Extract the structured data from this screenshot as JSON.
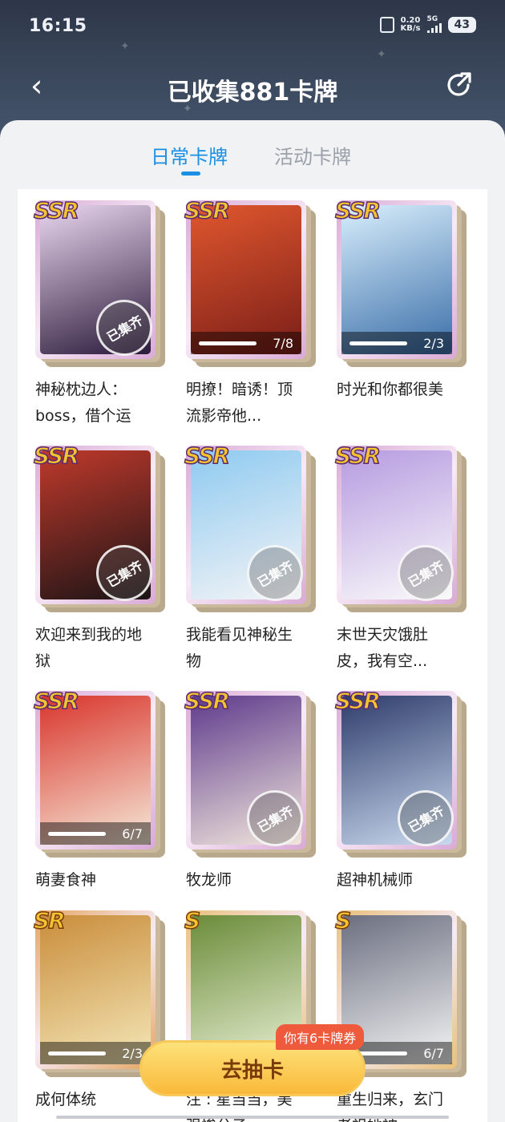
{
  "status_bar": {
    "time": "16:15",
    "speed_value": "0.20",
    "speed_unit": "KB/s",
    "network": "5G",
    "battery": "43"
  },
  "nav": {
    "title": "已收集881卡牌"
  },
  "tabs": [
    {
      "label": "日常卡牌",
      "active": true
    },
    {
      "label": "活动卡牌",
      "active": false
    }
  ],
  "cards": [
    {
      "rarity": "SSR",
      "title": "神秘枕边人：boss，借个运",
      "progress": "",
      "collected_stamp": "已集齐",
      "colors": [
        "#2b1a3a",
        "#e9d6ef"
      ],
      "frame": "#d9a9d6"
    },
    {
      "rarity": "SSR",
      "title": "明撩！暗诱！顶流影帝他...",
      "progress": "7/8",
      "collected_stamp": "",
      "colors": [
        "#7a1e18",
        "#e0572e"
      ],
      "frame": "#d9a9d6"
    },
    {
      "rarity": "SSR",
      "title": "时光和你都很美",
      "progress": "2/3",
      "collected_stamp": "",
      "colors": [
        "#3a6ea8",
        "#d8eefc"
      ],
      "frame": "#d9a9d6"
    },
    {
      "rarity": "SSR",
      "title": "欢迎来到我的地狱",
      "progress": "",
      "collected_stamp": "已集齐",
      "colors": [
        "#1b1416",
        "#c0392b"
      ],
      "frame": "#d9a9d6"
    },
    {
      "rarity": "SSR",
      "title": "我能看见神秘生物",
      "progress": "",
      "collected_stamp": "已集齐",
      "colors": [
        "#f4f4f6",
        "#8ecaf0"
      ],
      "frame": "#d9a9d6"
    },
    {
      "rarity": "SSR",
      "title": "末世天灾饿肚皮，我有空...",
      "progress": "",
      "collected_stamp": "已集齐",
      "colors": [
        "#fafafa",
        "#b69be0"
      ],
      "frame": "#d9a9d6"
    },
    {
      "rarity": "SSR",
      "title": "萌妻食神",
      "progress": "6/7",
      "collected_stamp": "",
      "colors": [
        "#f5e9d8",
        "#d9342b"
      ],
      "frame": "#d9a9d6"
    },
    {
      "rarity": "SSR",
      "title": "牧龙师",
      "progress": "",
      "collected_stamp": "已集齐",
      "colors": [
        "#f1e6dc",
        "#5e3a8c"
      ],
      "frame": "#d9a9d6"
    },
    {
      "rarity": "SSR",
      "title": "超神机械师",
      "progress": "",
      "collected_stamp": "已集齐",
      "colors": [
        "#c8d9ee",
        "#2e3c6b"
      ],
      "frame": "#d9a9d6"
    },
    {
      "rarity": "SR",
      "title": "成何体统",
      "progress": "2/3",
      "collected_stamp": "",
      "colors": [
        "#f4e7b8",
        "#c98d3b"
      ],
      "frame": "#e4a45e"
    },
    {
      "rarity": "S",
      "title": "注 : 星当当，美强惨公子",
      "progress": "",
      "collected_stamp": "",
      "colors": [
        "#e9f0d4",
        "#6b8c3a"
      ],
      "frame": "#e8c07a"
    },
    {
      "rarity": "S",
      "title": "重生归来，玄门老祖她被",
      "progress": "6/7",
      "collected_stamp": "",
      "colors": [
        "#f5f5f5",
        "#6b6f80"
      ],
      "frame": "#e8c07a"
    }
  ],
  "draw_button": {
    "label": "去抽卡",
    "tip": "你有6卡牌券"
  }
}
